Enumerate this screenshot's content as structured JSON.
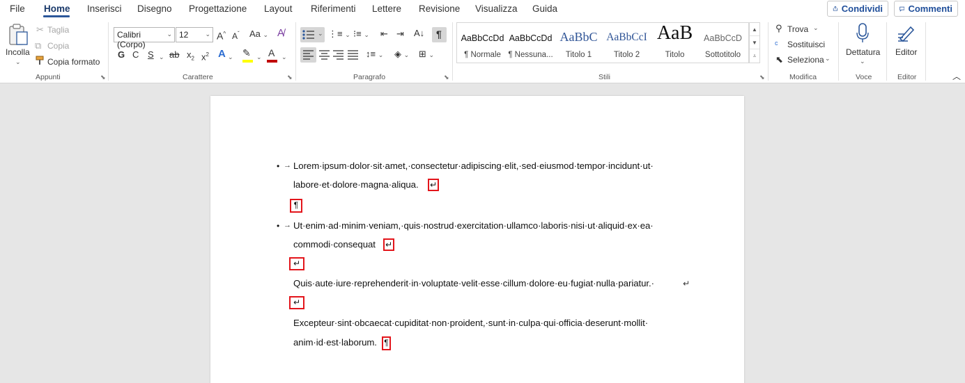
{
  "tabs": [
    "File",
    "Home",
    "Inserisci",
    "Disegno",
    "Progettazione",
    "Layout",
    "Riferimenti",
    "Lettere",
    "Revisione",
    "Visualizza",
    "Guida"
  ],
  "header_buttons": {
    "share": "Condividi",
    "comments": "Commenti"
  },
  "clipboard": {
    "paste": "Incolla",
    "cut": "Taglia",
    "copy": "Copia",
    "format_painter": "Copia formato",
    "label": "Appunti"
  },
  "font": {
    "name": "Calibri (Corpo)",
    "size": "12",
    "bold": "G",
    "italic": "C",
    "underline": "S",
    "label": "Carattere"
  },
  "paragraph": {
    "label": "Paragrafo",
    "pilcrow": "¶"
  },
  "styles": {
    "label": "Stili",
    "items": [
      {
        "sample": "AaBbCcDd",
        "name": "¶ Normale"
      },
      {
        "sample": "AaBbCcDd",
        "name": "¶ Nessuna..."
      },
      {
        "sample": "AaBbC",
        "name": "Titolo 1"
      },
      {
        "sample": "AaBbCcI",
        "name": "Titolo 2"
      },
      {
        "sample": "AaB",
        "name": "Titolo"
      },
      {
        "sample": "AaBbCcD",
        "name": "Sottotitolo"
      }
    ]
  },
  "editing": {
    "find": "Trova",
    "replace": "Sostituisci",
    "select": "Seleziona",
    "label": "Modifica"
  },
  "voice": {
    "dictate": "Dettatura",
    "label": "Voce"
  },
  "editor": {
    "button": "Editor",
    "label": "Editor"
  },
  "document": {
    "bullet1_line1": "Lorem·ipsum·dolor·sit·amet,·consectetur·adipiscing·elit,·sed·eiusmod·tempor·incidunt·ut·",
    "bullet1_line2": "labore·et·dolore·magna·aliqua.",
    "bullet2_line1": "Ut·enim·ad·minim·veniam,·quis·nostrud·exercitation·ullamco·laboris·nisi·ut·aliquid·ex·ea·",
    "bullet2_line2": "commodi·consequat",
    "line3": "Quis·aute·iure·reprehenderit·in·voluptate·velit·esse·cillum·dolore·eu·fugiat·nulla·pariatur.·",
    "line4": "Excepteur·sint·obcaecat·cupiditat·non·proident,·sunt·in·culpa·qui·officia·deserunt·mollit·",
    "line5": "anim·id·est·laborum.",
    "line_break_mark": "↵",
    "pilcrow_mark": "¶",
    "bullet_char": "•",
    "tab_arrow": "→"
  },
  "colors": {
    "accent": "#2b579a",
    "highlight_box": "#e3151b",
    "font_color": "#c00000",
    "highlighter": "#ffff00"
  }
}
